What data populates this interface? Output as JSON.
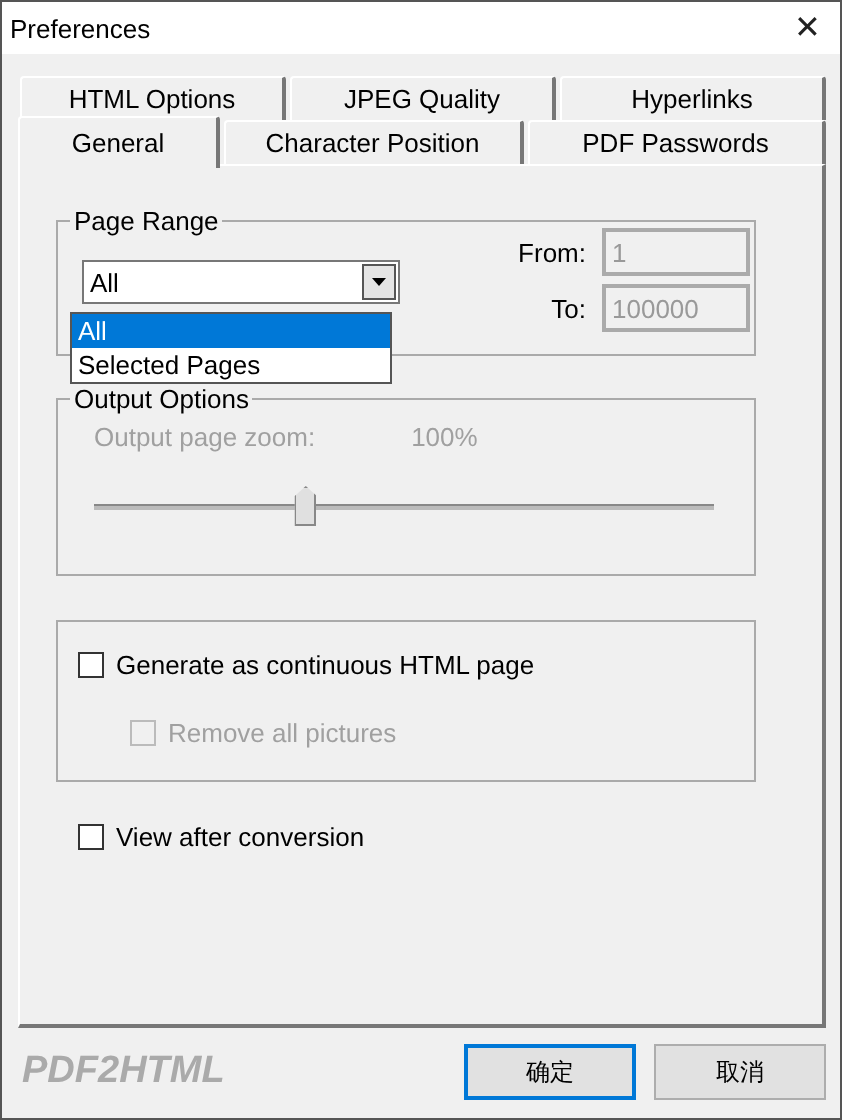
{
  "window": {
    "title": "Preferences",
    "close": "✕"
  },
  "tab_rows": [
    [
      {
        "label": "HTML Options",
        "selected": false
      },
      {
        "label": "JPEG Quality",
        "selected": false
      },
      {
        "label": "Hyperlinks",
        "selected": false
      }
    ],
    [
      {
        "label": "General",
        "selected": true
      },
      {
        "label": "Character Position",
        "selected": false
      },
      {
        "label": "PDF Passwords",
        "selected": false
      }
    ]
  ],
  "page_range": {
    "title": "Page Range",
    "combo": {
      "value": "All",
      "expanded": true,
      "options": [
        {
          "label": "All",
          "selected": true
        },
        {
          "label": "Selected Pages",
          "selected": false
        }
      ]
    },
    "from": {
      "label": "From:",
      "value": "1",
      "disabled": true
    },
    "to": {
      "label": "To:",
      "value": "100000",
      "disabled": true
    }
  },
  "output_options": {
    "title": "Output Options",
    "zoom_label": "Output page zoom:",
    "zoom_value": "100%",
    "disabled": true,
    "level": 0.34
  },
  "html_group": [
    {
      "label": "Generate as continuous HTML page",
      "checked": false,
      "disabled": false,
      "indent": false
    },
    {
      "label": "Remove all pictures",
      "checked": false,
      "disabled": true,
      "indent": true
    }
  ],
  "view_after": {
    "label": "View after conversion",
    "checked": false,
    "disabled": false
  },
  "logo": "PDF2HTML",
  "buttons": [
    "确定",
    "取消"
  ]
}
